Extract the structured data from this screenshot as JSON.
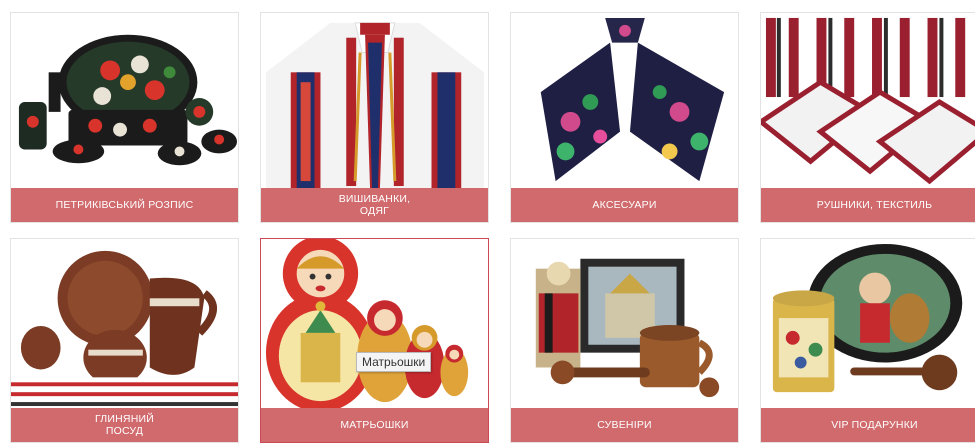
{
  "categories": [
    {
      "label": "ПЕТРИКІВСЬКИЙ РОЗПИС",
      "icon": "petrykivka-plates-image"
    },
    {
      "label_line1": "ВИШИВАНКИ,",
      "label_line2": "ОДЯГ",
      "icon": "embroidered-shirt-image"
    },
    {
      "label": "АКСЕСУАРИ",
      "icon": "scarf-image"
    },
    {
      "label": "РУШНИКИ, ТЕКСТИЛЬ",
      "icon": "towels-image"
    },
    {
      "label_line1": "ГЛИНЯНИЙ",
      "label_line2": "ПОСУД",
      "icon": "clay-pottery-image"
    },
    {
      "label": "МАТРЬОШКИ",
      "icon": "matryoshka-image"
    },
    {
      "label": "СУВЕНІРИ",
      "icon": "souvenirs-image"
    },
    {
      "label": "VIP ПОДАРУНКИ",
      "icon": "vip-gifts-image"
    }
  ],
  "tooltip": {
    "text": "Матрьошки"
  },
  "colors": {
    "label_bg": "#d06a6d",
    "label_text": "#ffffff",
    "tile_border": "#e3e3e3"
  }
}
